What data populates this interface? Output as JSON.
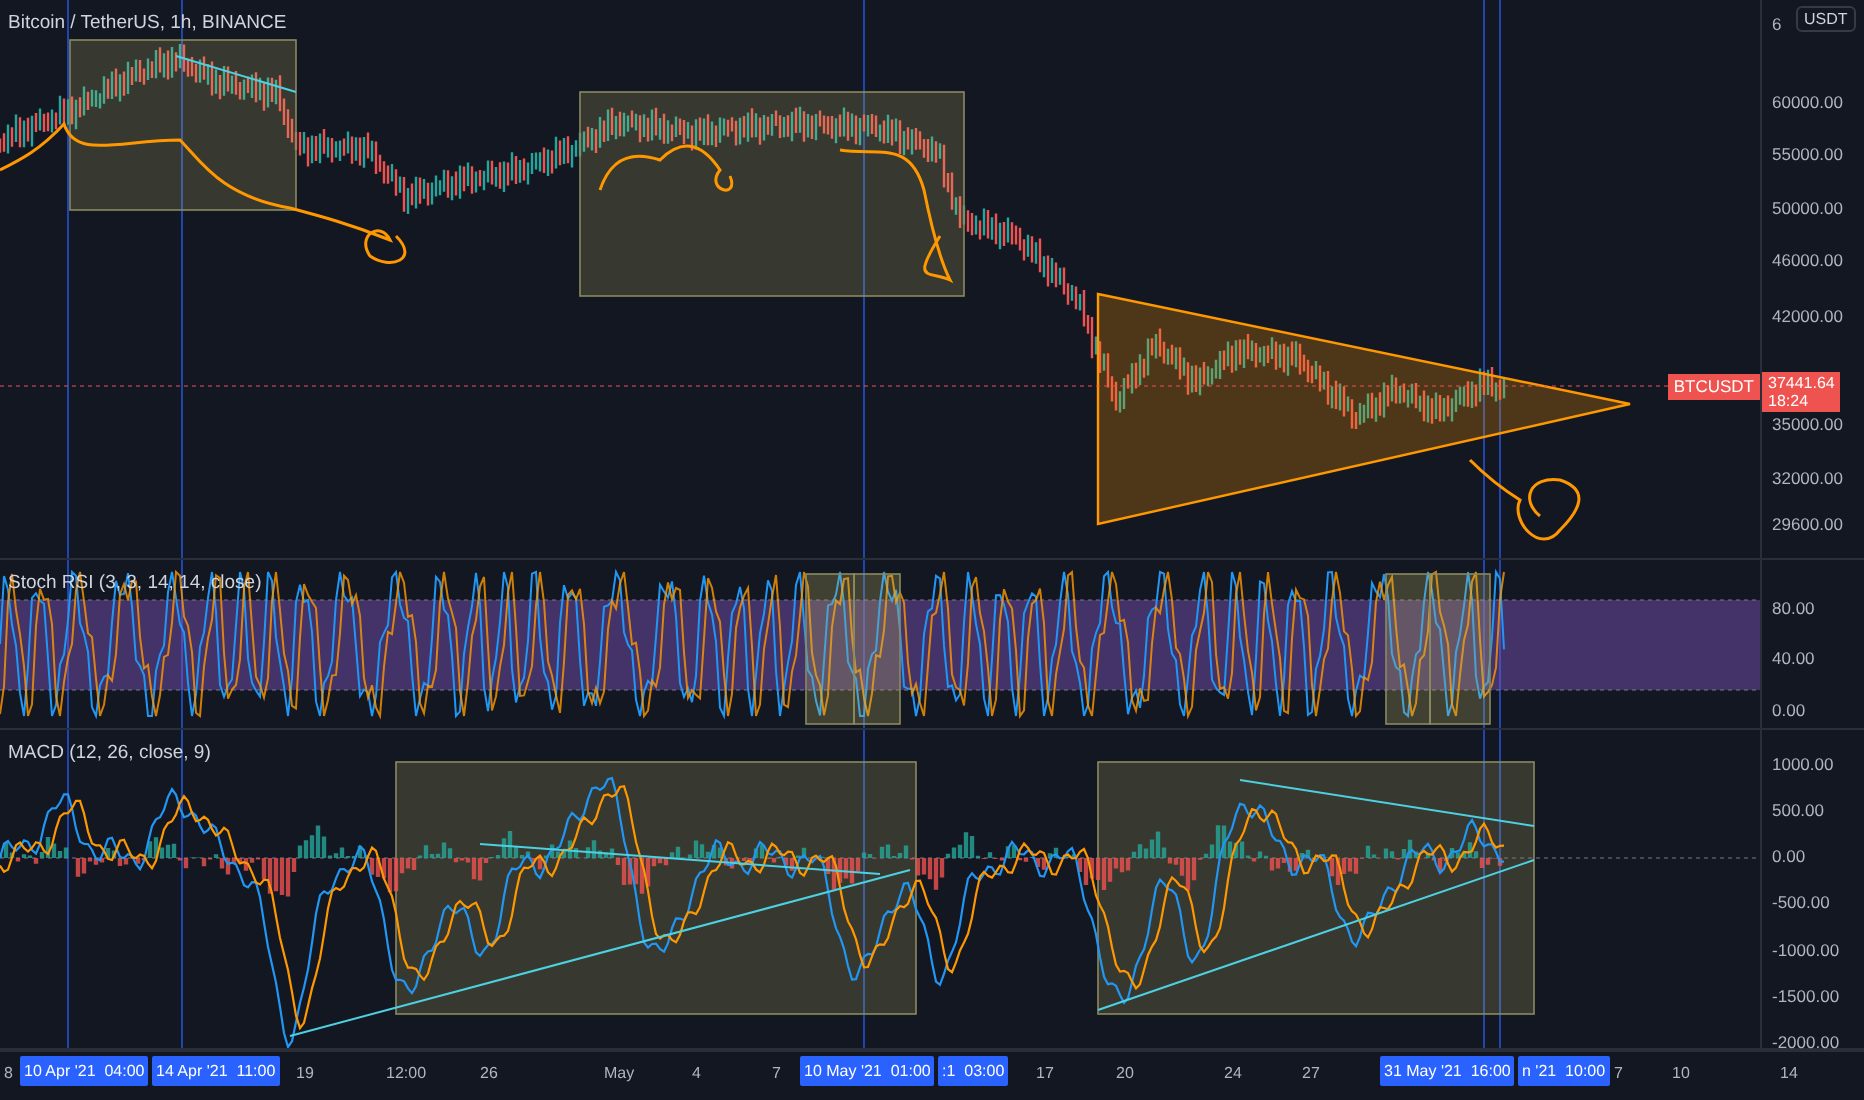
{
  "header": {
    "title": "Bitcoin / TetherUS, 1h, BINANCE"
  },
  "price_axis": {
    "unit": "USDT",
    "labels": [
      "6",
      "60000.00",
      "55000.00",
      "50000.00",
      "46000.00",
      "42000.00",
      "35000.00",
      "32000.00",
      "29600.00"
    ]
  },
  "price_tag": {
    "symbol": "BTCUSDT",
    "price": "37441.64",
    "countdown": "18:24"
  },
  "stoch_rsi": {
    "title": "Stoch RSI (3, 3, 14, 14, close)",
    "labels": [
      "80.00",
      "40.00",
      "0.00"
    ]
  },
  "macd": {
    "title": "MACD (12, 26, close, 9)",
    "labels": [
      "1000.00",
      "500.00",
      "0.00",
      "-500.00",
      "-1000.00",
      "-1500.00",
      "-2000.00"
    ]
  },
  "time_axis": {
    "labels": [
      {
        "text": "8",
        "highlighted": false
      },
      {
        "text": "10 Apr '21  04:00",
        "highlighted": true
      },
      {
        "text": "14 Apr '21  11:00",
        "highlighted": true
      },
      {
        "text": "19",
        "highlighted": false
      },
      {
        "text": "12:00",
        "highlighted": false
      },
      {
        "text": "26",
        "highlighted": false
      },
      {
        "text": "May",
        "highlighted": false
      },
      {
        "text": "4",
        "highlighted": false
      },
      {
        "text": "7",
        "highlighted": false
      },
      {
        "text": "10 May '21  01:00",
        "highlighted": true
      },
      {
        "text": ":1  03:00",
        "highlighted": true
      },
      {
        "text": "17",
        "highlighted": false
      },
      {
        "text": "20",
        "highlighted": false
      },
      {
        "text": "24",
        "highlighted": false
      },
      {
        "text": "27",
        "highlighted": false
      },
      {
        "text": "31 May '21  16:00",
        "highlighted": true
      },
      {
        "text": "n '21  10:00",
        "highlighted": true
      },
      {
        "text": "7",
        "highlighted": false
      },
      {
        "text": "10",
        "highlighted": false
      },
      {
        "text": "14",
        "highlighted": false
      }
    ]
  }
}
